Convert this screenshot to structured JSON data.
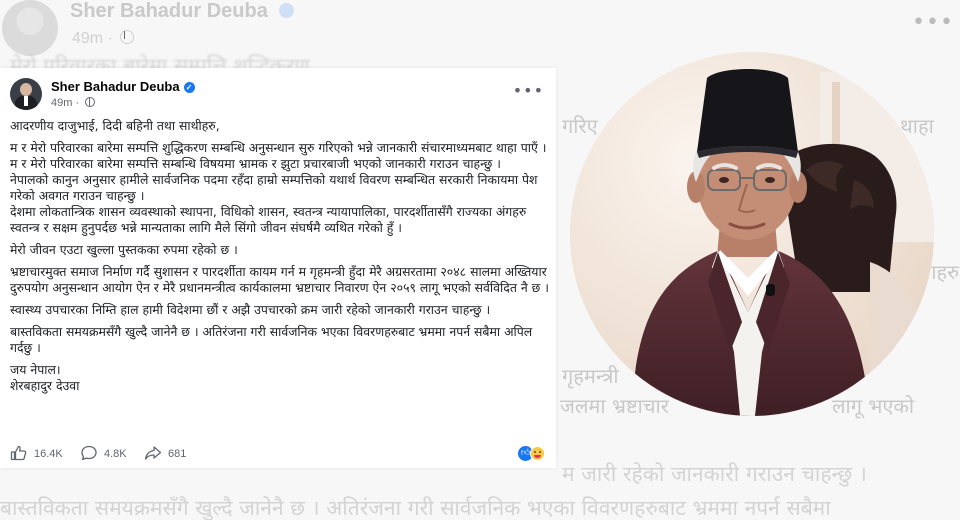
{
  "background": {
    "name": "Sher Bahadur Deuba",
    "time": "49m · ",
    "lines": [
      "मेरो परिवारका बारेमा सम्पत्ति शुद्धिकरण",
      "म जारी रहेको जानकारी गराउन चाहन्छु ।",
      "बास्तविकता समयक्रमसँगै खुल्दै जानेनै छ । अतिरंजना गरी सार्वजनिक भएका विवरणहरुबाट भ्रममा नपर्न सबैमा"
    ],
    "right_fragments": [
      "गरिए",
      "थाहा",
      "अंगहरु",
      "गृहमन्त्री",
      "जलमा भ्रष्टाचार",
      "लागू भएको"
    ]
  },
  "post": {
    "author": "Sher Bahadur Deuba",
    "time": "49m",
    "paragraphs": [
      "आदरणीय दाजुभाई, दिदी बहिनी तथा साथीहरु,",
      "म र मेरो परिवारका बारेमा सम्पत्ति शुद्धिकरण सम्बन्धि अनुसन्धान सुरु गरिएको भन्ने जानकारी संचारमाध्यमबाट थाहा पाएँ ।",
      "म र मेरो परिवारका बारेमा सम्पत्ति सम्बन्धि विषयमा भ्रामक र झुटा प्रचारबाजी भएको जानकारी गराउन चाहन्छु ।",
      "नेपालको कानुन अनुसार हामीले सार्वजनिक पदमा रहँदा हाम्रो सम्पत्तिको यथार्थ विवरण सम्बन्धित सरकारी निकायमा पेश गरेको अवगत गराउन चाहन्छु ।",
      "देशमा लोकतान्त्रिक शासन व्यवस्थाको स्थापना, विधिको शासन, स्वतन्त्र न्यायापालिका, पारदर्शीतासँगै राज्यका अंगहरु स्वतन्त्र र सक्षम हुनुपर्दछ भन्ने मान्यताका लागि मैले सिंगो जीवन संघर्षमै व्यथित गरेको हुँ ।",
      "मेरो जीवन एउटा खुल्ला पुस्तकका रुपमा रहेको छ ।",
      "भ्रष्टाचारमुक्त समाज निर्माण गर्दै सुशासन र पारदर्शीता कायम गर्न म गृहमन्त्री हुँदा मेरै अग्रसरतामा २०४८ सालमा अख्तियार दुरुपयोग अनुसन्धान आयोग ऐन र मेरै प्रधानमन्त्रीत्व कार्यकालमा भ्रष्टाचार निवारण ऐन २०५९ लागू भएको सर्वविदित नै छ ।",
      "स्वास्थ्य उपचारका निम्ति हाल हामी विदेशमा छौं र अझै उपचारको क्रम जारी रहेको जानकारी गराउन चाहन्छु ।",
      "बास्तविकता समयक्रमसँगै खुल्दै जानेनै छ । अतिरंजना गरी सार्वजनिक भएका विवरणहरुबाट भ्रममा नपर्न सबैमा अपिल गर्दछु ।",
      "जय नेपाल।",
      "शेरबहादुर देउवा"
    ],
    "actions": {
      "likes": "16.4K",
      "comments": "4.8K",
      "shares": "681"
    }
  },
  "colors": {
    "accent": "#1877f2",
    "cap": "#16161a",
    "coat": "#5a2e35",
    "skin": "#c48d76"
  }
}
